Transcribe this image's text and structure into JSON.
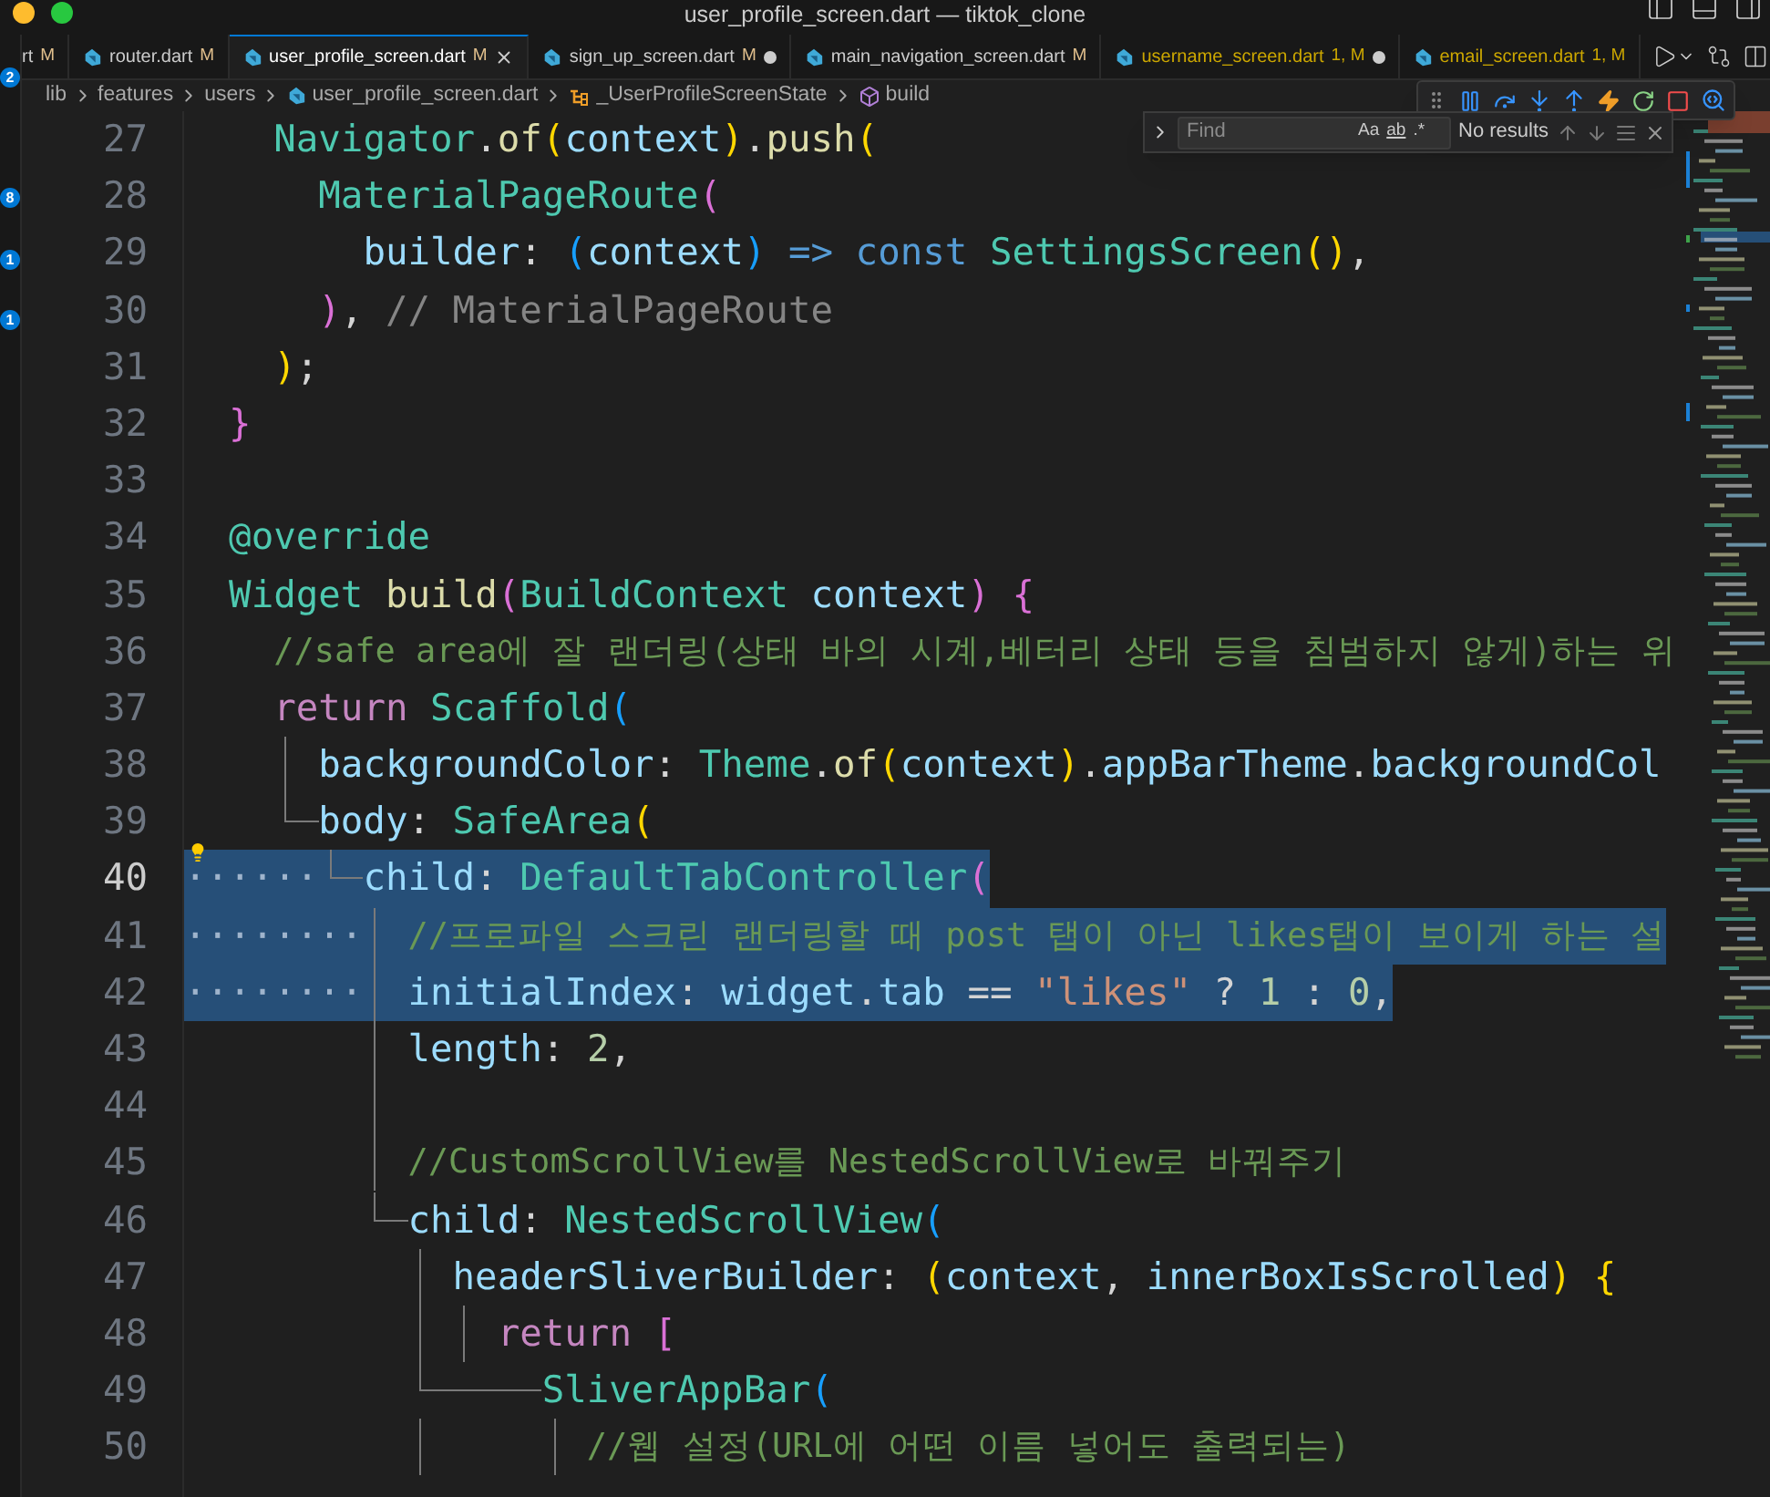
{
  "window": {
    "title": "user_profile_screen.dart — tiktok_clone"
  },
  "activity_badges": [
    "2",
    "8",
    "1",
    "1"
  ],
  "tabs": [
    {
      "label": "rt",
      "status": "M",
      "selected": false,
      "warning": false,
      "dirty": false
    },
    {
      "label": "router.dart",
      "status": "M",
      "selected": false,
      "warning": false,
      "dirty": false
    },
    {
      "label": "user_profile_screen.dart",
      "status": "M",
      "selected": true,
      "warning": false,
      "dirty": false
    },
    {
      "label": "sign_up_screen.dart",
      "status": "M",
      "selected": false,
      "warning": false,
      "dirty": true
    },
    {
      "label": "main_navigation_screen.dart",
      "status": "M",
      "selected": false,
      "warning": false,
      "dirty": false
    },
    {
      "label": "username_screen.dart",
      "status": "1, M",
      "selected": false,
      "warning": true,
      "dirty": true
    },
    {
      "label": "email_screen.dart",
      "status": "1, M",
      "selected": false,
      "warning": true,
      "dirty": false
    }
  ],
  "breadcrumbs": [
    {
      "kind": "folder",
      "label": "lib"
    },
    {
      "kind": "folder",
      "label": "features"
    },
    {
      "kind": "folder",
      "label": "users"
    },
    {
      "kind": "file",
      "label": "user_profile_screen.dart"
    },
    {
      "kind": "class",
      "label": "_UserProfileScreenState"
    },
    {
      "kind": "method",
      "label": "build"
    }
  ],
  "find": {
    "placeholder": "Find",
    "options": [
      "Aa",
      "ab",
      ".*"
    ],
    "result": "No results"
  },
  "lines": [
    {
      "num": "27",
      "current": false,
      "selected": false,
      "code": [
        {
          "kind": "indent"
        },
        {
          "kind": "indent"
        },
        {
          "kind": "type",
          "text": "Navigator"
        },
        {
          "kind": "punct",
          "text": "."
        },
        {
          "kind": "func",
          "text": "of"
        },
        {
          "kind": "bracket1",
          "text": "("
        },
        {
          "kind": "ident",
          "text": "context"
        },
        {
          "kind": "bracket1",
          "text": ")"
        },
        {
          "kind": "punct",
          "text": "."
        },
        {
          "kind": "func",
          "text": "push"
        },
        {
          "kind": "bracket1",
          "text": "("
        }
      ]
    },
    {
      "num": "28",
      "current": false,
      "selected": false,
      "code": [
        {
          "kind": "indent"
        },
        {
          "kind": "indent"
        },
        {
          "kind": "indent"
        },
        {
          "kind": "type",
          "text": "MaterialPageRoute"
        },
        {
          "kind": "bracket2",
          "text": "("
        }
      ]
    },
    {
      "num": "29",
      "current": false,
      "selected": false,
      "code": [
        {
          "kind": "indent"
        },
        {
          "kind": "indent"
        },
        {
          "kind": "indent"
        },
        {
          "kind": "indent"
        },
        {
          "kind": "ident",
          "text": "builder"
        },
        {
          "kind": "punct",
          "text": ":"
        },
        {
          "kind": "bracket3",
          "text": " ("
        },
        {
          "kind": "ident",
          "text": "context"
        },
        {
          "kind": "bracket3",
          "text": ")"
        },
        {
          "kind": "keyword",
          "text": " =>"
        },
        {
          "kind": "keyword",
          "text": " const"
        },
        {
          "kind": "type",
          "text": " SettingsScreen"
        },
        {
          "kind": "bracket1",
          "text": "()"
        },
        {
          "kind": "punct",
          "text": ","
        }
      ]
    },
    {
      "num": "30",
      "current": false,
      "selected": false,
      "code": [
        {
          "kind": "indent"
        },
        {
          "kind": "indent"
        },
        {
          "kind": "indent"
        },
        {
          "kind": "bracket2",
          "text": ")"
        },
        {
          "kind": "punct",
          "text": ","
        },
        {
          "kind": "label",
          "text": " // MaterialPageRoute"
        }
      ]
    },
    {
      "num": "31",
      "current": false,
      "selected": false,
      "code": [
        {
          "kind": "indent"
        },
        {
          "kind": "indent"
        },
        {
          "kind": "bracket1",
          "text": ")"
        },
        {
          "kind": "punct",
          "text": ";"
        }
      ]
    },
    {
      "num": "32",
      "current": false,
      "selected": false,
      "code": [
        {
          "kind": "indent"
        },
        {
          "kind": "bracket2",
          "text": "}"
        }
      ]
    },
    {
      "num": "33",
      "current": false,
      "selected": false
    },
    {
      "num": "34",
      "current": false,
      "selected": false,
      "code": [
        {
          "kind": "indent"
        },
        {
          "kind": "type",
          "text": "@override"
        }
      ]
    },
    {
      "num": "35",
      "current": false,
      "selected": false,
      "code": [
        {
          "kind": "indent"
        },
        {
          "kind": "type",
          "text": "Widget"
        },
        {
          "kind": "func",
          "text": " build"
        },
        {
          "kind": "bracket2",
          "text": "("
        },
        {
          "kind": "type",
          "text": "BuildContext"
        },
        {
          "kind": "ident",
          "text": " context"
        },
        {
          "kind": "bracket2",
          "text": ")"
        },
        {
          "kind": "bracket2",
          "text": " {"
        }
      ]
    },
    {
      "num": "36",
      "current": false,
      "selected": false,
      "code": [
        {
          "kind": "indent"
        },
        {
          "kind": "indent"
        },
        {
          "kind": "comment",
          "text": "//safe area에 잘 랜더링(상태 바의 시계,베터리 상태 등을 침범하지 않게)하는 위"
        }
      ]
    },
    {
      "num": "37",
      "current": false,
      "selected": false,
      "code": [
        {
          "kind": "indent"
        },
        {
          "kind": "indent"
        },
        {
          "kind": "control",
          "text": "return"
        },
        {
          "kind": "type",
          "text": " Scaffold"
        },
        {
          "kind": "bracket3",
          "text": "("
        }
      ]
    },
    {
      "num": "38",
      "current": false,
      "selected": false,
      "code": [
        {
          "kind": "indent"
        },
        {
          "kind": "indent"
        },
        {
          "kind": "bar"
        },
        {
          "kind": "ident",
          "text": "backgroundColor"
        },
        {
          "kind": "punct",
          "text": ":"
        },
        {
          "kind": "type",
          "text": " Theme"
        },
        {
          "kind": "punct",
          "text": "."
        },
        {
          "kind": "func",
          "text": "of"
        },
        {
          "kind": "bracket1",
          "text": "("
        },
        {
          "kind": "ident",
          "text": "context"
        },
        {
          "kind": "bracket1",
          "text": ")"
        },
        {
          "kind": "punct",
          "text": "."
        },
        {
          "kind": "ident",
          "text": "appBarTheme"
        },
        {
          "kind": "punct",
          "text": "."
        },
        {
          "kind": "ident",
          "text": "backgroundCol"
        }
      ]
    },
    {
      "num": "39",
      "current": false,
      "selected": false,
      "code": [
        {
          "kind": "indent"
        },
        {
          "kind": "indent"
        },
        {
          "kind": "corner"
        },
        {
          "kind": "dash"
        },
        {
          "kind": "ident",
          "text": "body"
        },
        {
          "kind": "punct",
          "text": ":"
        },
        {
          "kind": "type",
          "text": " SafeArea"
        },
        {
          "kind": "bracket1",
          "text": "("
        }
      ]
    },
    {
      "num": "40",
      "current": true,
      "selected": true,
      "code": [
        {
          "kind": "whitespace",
          "text": "······"
        },
        {
          "kind": "corner"
        },
        {
          "kind": "dash"
        },
        {
          "kind": "ident",
          "text": "child"
        },
        {
          "kind": "punct",
          "text": ":"
        },
        {
          "kind": "type",
          "text": " DefaultTabController"
        },
        {
          "kind": "bracket2",
          "text": "("
        }
      ]
    },
    {
      "num": "41",
      "current": false,
      "selected": true,
      "code": [
        {
          "kind": "whitespace",
          "text": "········"
        },
        {
          "kind": "bar"
        },
        {
          "kind": "comment",
          "text": "//프로파일 스크린 랜더링할 때 post 탭이 아닌 likes탭이 보이게 하는 설"
        }
      ]
    },
    {
      "num": "42",
      "current": false,
      "selected": true,
      "code": [
        {
          "kind": "whitespace",
          "text": "········"
        },
        {
          "kind": "bar"
        },
        {
          "kind": "ident",
          "text": "initialIndex"
        },
        {
          "kind": "punct",
          "text": ":"
        },
        {
          "kind": "ident",
          "text": " widget"
        },
        {
          "kind": "punct",
          "text": "."
        },
        {
          "kind": "ident",
          "text": "tab"
        },
        {
          "kind": "punct",
          "text": " =="
        },
        {
          "kind": "string",
          "text": " \"likes\""
        },
        {
          "kind": "punct",
          "text": " ?"
        },
        {
          "kind": "number",
          "text": " 1"
        },
        {
          "kind": "punct",
          "text": " :"
        },
        {
          "kind": "number",
          "text": " 0"
        },
        {
          "kind": "punct",
          "text": ","
        }
      ]
    },
    {
      "num": "43",
      "current": false,
      "selected": false,
      "code": [
        {
          "kind": "indent"
        },
        {
          "kind": "indent"
        },
        {
          "kind": "indent"
        },
        {
          "kind": "indent"
        },
        {
          "kind": "bar"
        },
        {
          "kind": "ident",
          "text": "length"
        },
        {
          "kind": "punct",
          "text": ":"
        },
        {
          "kind": "number",
          "text": " 2"
        },
        {
          "kind": "punct",
          "text": ","
        }
      ]
    },
    {
      "num": "44",
      "current": false,
      "selected": false,
      "code": [
        {
          "kind": "indent"
        },
        {
          "kind": "indent"
        },
        {
          "kind": "indent"
        },
        {
          "kind": "indent"
        },
        {
          "kind": "bar"
        }
      ]
    },
    {
      "num": "45",
      "current": false,
      "selected": false,
      "code": [
        {
          "kind": "indent"
        },
        {
          "kind": "indent"
        },
        {
          "kind": "indent"
        },
        {
          "kind": "indent"
        },
        {
          "kind": "bar"
        },
        {
          "kind": "comment",
          "text": "//CustomScrollView를 NestedScrollView로 바꿔주기"
        }
      ]
    },
    {
      "num": "46",
      "current": false,
      "selected": false,
      "code": [
        {
          "kind": "indent"
        },
        {
          "kind": "indent"
        },
        {
          "kind": "indent"
        },
        {
          "kind": "indent"
        },
        {
          "kind": "corner"
        },
        {
          "kind": "dash"
        },
        {
          "kind": "ident",
          "text": "child"
        },
        {
          "kind": "punct",
          "text": ":"
        },
        {
          "kind": "type",
          "text": " NestedScrollView"
        },
        {
          "kind": "bracket3",
          "text": "("
        }
      ]
    },
    {
      "num": "47",
      "current": false,
      "selected": false,
      "code": [
        {
          "kind": "indent"
        },
        {
          "kind": "indent"
        },
        {
          "kind": "indent"
        },
        {
          "kind": "indent"
        },
        {
          "kind": "indent"
        },
        {
          "kind": "bar"
        },
        {
          "kind": "ident",
          "text": "headerSliverBuilder"
        },
        {
          "kind": "punct",
          "text": ":"
        },
        {
          "kind": "bracket1",
          "text": " ("
        },
        {
          "kind": "ident",
          "text": "context"
        },
        {
          "kind": "punct",
          "text": ","
        },
        {
          "kind": "ident",
          "text": " innerBoxIsScrolled"
        },
        {
          "kind": "bracket1",
          "text": ")"
        },
        {
          "kind": "bracket1",
          "text": " {"
        }
      ]
    },
    {
      "num": "48",
      "current": false,
      "selected": false,
      "code": [
        {
          "kind": "indent"
        },
        {
          "kind": "indent"
        },
        {
          "kind": "indent"
        },
        {
          "kind": "indent"
        },
        {
          "kind": "indent"
        },
        {
          "kind": "bar"
        },
        {
          "kind": "bar"
        },
        {
          "kind": "control",
          "text": "return"
        },
        {
          "kind": "bracket2",
          "text": " ["
        }
      ]
    },
    {
      "num": "49",
      "current": false,
      "selected": false,
      "code": [
        {
          "kind": "indent"
        },
        {
          "kind": "indent"
        },
        {
          "kind": "indent"
        },
        {
          "kind": "indent"
        },
        {
          "kind": "indent"
        },
        {
          "kind": "corner"
        },
        {
          "kind": "dash"
        },
        {
          "kind": "dash"
        },
        {
          "kind": "dash"
        },
        {
          "kind": "dash"
        },
        {
          "kind": "dash"
        },
        {
          "kind": "type",
          "text": "SliverAppBar"
        },
        {
          "kind": "bracket3",
          "text": "("
        }
      ]
    },
    {
      "num": "50",
      "current": false,
      "selected": false,
      "code": [
        {
          "kind": "indent"
        },
        {
          "kind": "indent"
        },
        {
          "kind": "indent"
        },
        {
          "kind": "indent"
        },
        {
          "kind": "indent"
        },
        {
          "kind": "bar"
        },
        {
          "kind": "indent"
        },
        {
          "kind": "indent"
        },
        {
          "kind": "bar"
        },
        {
          "kind": "comment",
          "text": "//웹 설정(URL에 어떤 이름 넣어도 출력되는)"
        }
      ]
    }
  ]
}
